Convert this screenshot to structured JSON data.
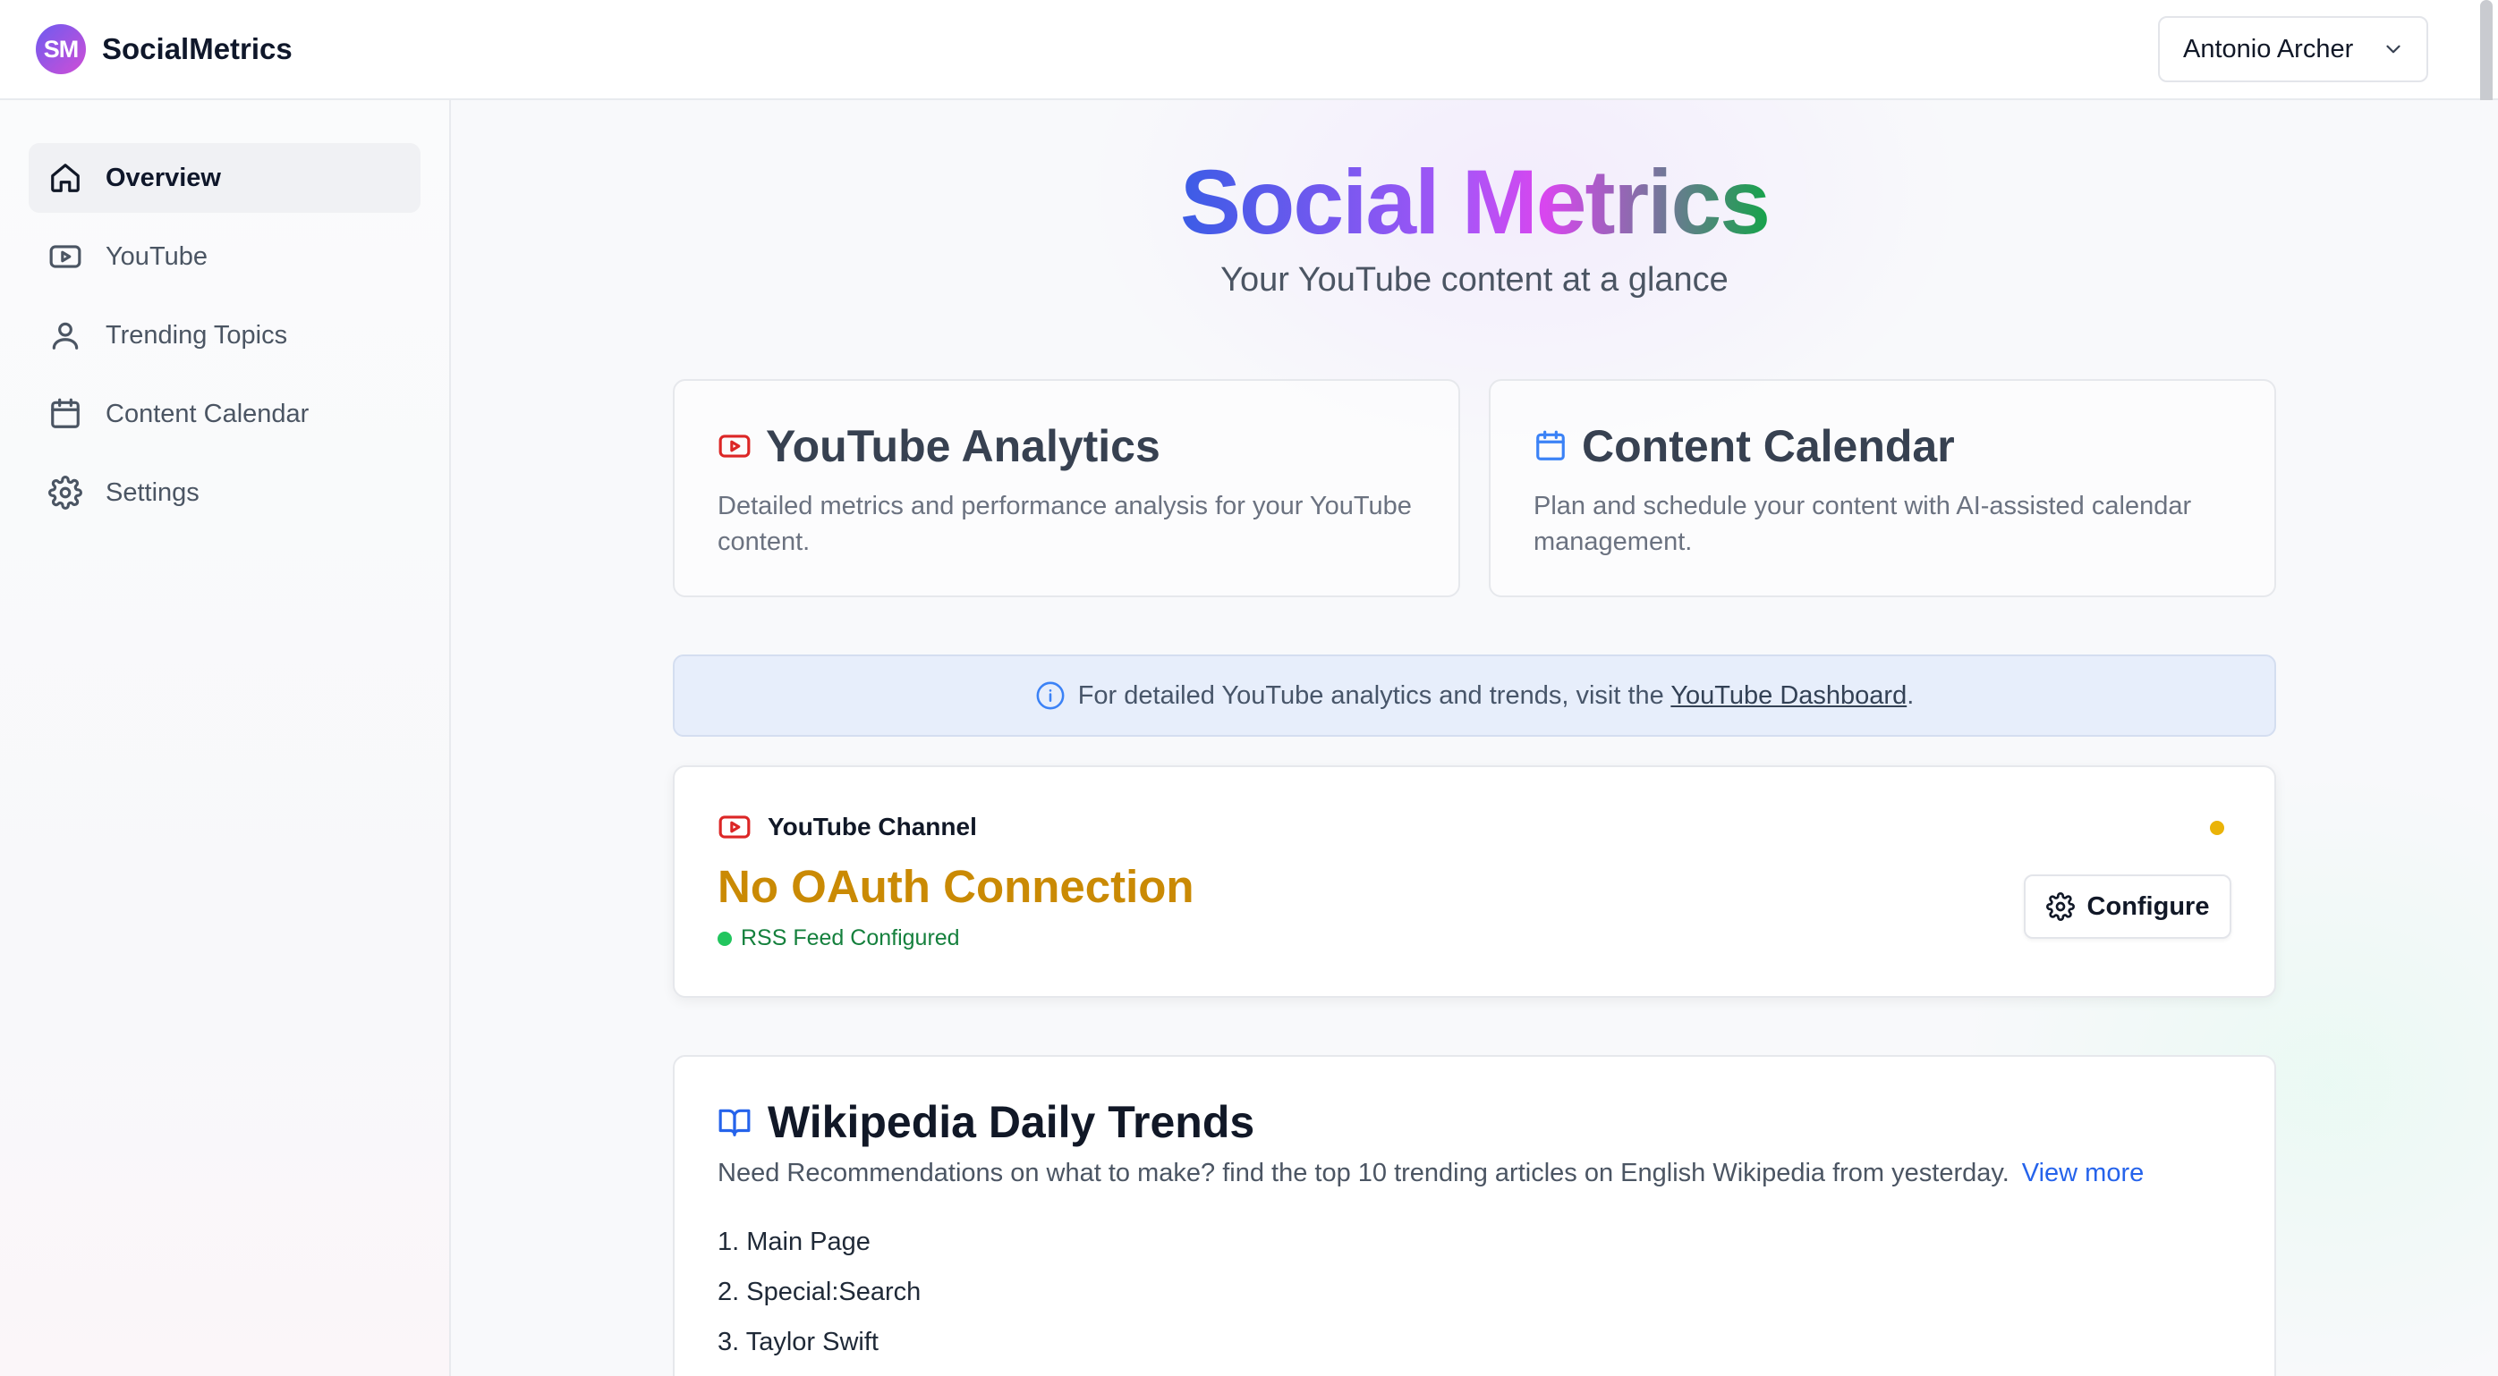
{
  "header": {
    "logo_text": "SM",
    "brand_name": "SocialMetrics",
    "user_name": "Antonio Archer"
  },
  "sidebar": {
    "items": [
      {
        "label": "Overview",
        "icon": "home-icon",
        "active": true
      },
      {
        "label": "YouTube",
        "icon": "youtube-icon",
        "active": false
      },
      {
        "label": "Trending Topics",
        "icon": "user-icon",
        "active": false
      },
      {
        "label": "Content Calendar",
        "icon": "calendar-icon",
        "active": false
      },
      {
        "label": "Settings",
        "icon": "gear-icon",
        "active": false
      }
    ]
  },
  "hero": {
    "title": "Social Metrics",
    "subtitle": "Your YouTube content at a glance"
  },
  "features": [
    {
      "title": "YouTube Analytics",
      "description": "Detailed metrics and performance analysis for your YouTube content.",
      "icon": "youtube-icon"
    },
    {
      "title": "Content Calendar",
      "description": "Plan and schedule your content with AI-assisted calendar management.",
      "icon": "calendar-icon"
    }
  ],
  "info_banner": {
    "text": "For detailed YouTube analytics and trends, visit the",
    "link_text": "YouTube Dashboard",
    "suffix": "."
  },
  "channel": {
    "label": "YouTube Channel",
    "status": "No OAuth Connection",
    "rss_status": "RSS Feed Configured",
    "configure_label": "Configure",
    "status_color": "#eab308"
  },
  "wiki": {
    "title": "Wikipedia Daily Trends",
    "description": "Need Recommendations on what to make? find the top 10 trending articles on English Wikipedia from yesterday.",
    "link_text": "View more",
    "articles": [
      "1. Main Page",
      "2. Special:Search",
      "3. Taylor Swift"
    ]
  },
  "colors": {
    "accent_blue": "#2563eb",
    "warning": "#ca8a04",
    "success": "#22c55e",
    "youtube_red": "#dc2626"
  }
}
